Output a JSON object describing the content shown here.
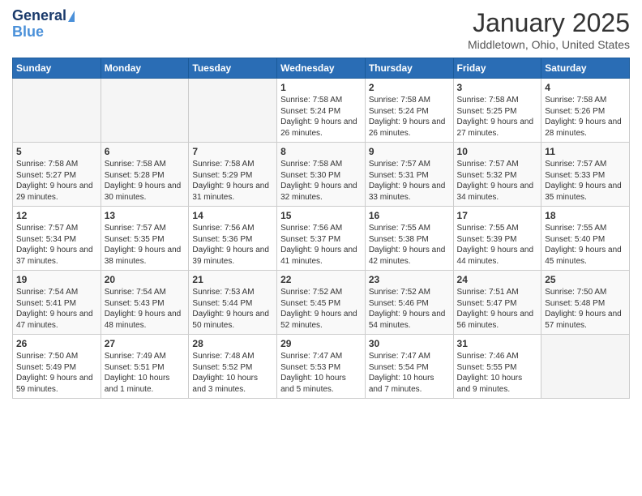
{
  "logo": {
    "line1": "General",
    "line2": "Blue"
  },
  "header": {
    "month": "January 2025",
    "location": "Middletown, Ohio, United States"
  },
  "weekdays": [
    "Sunday",
    "Monday",
    "Tuesday",
    "Wednesday",
    "Thursday",
    "Friday",
    "Saturday"
  ],
  "weeks": [
    [
      {
        "day": "",
        "sunrise": "",
        "sunset": "",
        "daylight": ""
      },
      {
        "day": "",
        "sunrise": "",
        "sunset": "",
        "daylight": ""
      },
      {
        "day": "",
        "sunrise": "",
        "sunset": "",
        "daylight": ""
      },
      {
        "day": "1",
        "sunrise": "Sunrise: 7:58 AM",
        "sunset": "Sunset: 5:24 PM",
        "daylight": "Daylight: 9 hours and 26 minutes."
      },
      {
        "day": "2",
        "sunrise": "Sunrise: 7:58 AM",
        "sunset": "Sunset: 5:24 PM",
        "daylight": "Daylight: 9 hours and 26 minutes."
      },
      {
        "day": "3",
        "sunrise": "Sunrise: 7:58 AM",
        "sunset": "Sunset: 5:25 PM",
        "daylight": "Daylight: 9 hours and 27 minutes."
      },
      {
        "day": "4",
        "sunrise": "Sunrise: 7:58 AM",
        "sunset": "Sunset: 5:26 PM",
        "daylight": "Daylight: 9 hours and 28 minutes."
      }
    ],
    [
      {
        "day": "5",
        "sunrise": "Sunrise: 7:58 AM",
        "sunset": "Sunset: 5:27 PM",
        "daylight": "Daylight: 9 hours and 29 minutes."
      },
      {
        "day": "6",
        "sunrise": "Sunrise: 7:58 AM",
        "sunset": "Sunset: 5:28 PM",
        "daylight": "Daylight: 9 hours and 30 minutes."
      },
      {
        "day": "7",
        "sunrise": "Sunrise: 7:58 AM",
        "sunset": "Sunset: 5:29 PM",
        "daylight": "Daylight: 9 hours and 31 minutes."
      },
      {
        "day": "8",
        "sunrise": "Sunrise: 7:58 AM",
        "sunset": "Sunset: 5:30 PM",
        "daylight": "Daylight: 9 hours and 32 minutes."
      },
      {
        "day": "9",
        "sunrise": "Sunrise: 7:57 AM",
        "sunset": "Sunset: 5:31 PM",
        "daylight": "Daylight: 9 hours and 33 minutes."
      },
      {
        "day": "10",
        "sunrise": "Sunrise: 7:57 AM",
        "sunset": "Sunset: 5:32 PM",
        "daylight": "Daylight: 9 hours and 34 minutes."
      },
      {
        "day": "11",
        "sunrise": "Sunrise: 7:57 AM",
        "sunset": "Sunset: 5:33 PM",
        "daylight": "Daylight: 9 hours and 35 minutes."
      }
    ],
    [
      {
        "day": "12",
        "sunrise": "Sunrise: 7:57 AM",
        "sunset": "Sunset: 5:34 PM",
        "daylight": "Daylight: 9 hours and 37 minutes."
      },
      {
        "day": "13",
        "sunrise": "Sunrise: 7:57 AM",
        "sunset": "Sunset: 5:35 PM",
        "daylight": "Daylight: 9 hours and 38 minutes."
      },
      {
        "day": "14",
        "sunrise": "Sunrise: 7:56 AM",
        "sunset": "Sunset: 5:36 PM",
        "daylight": "Daylight: 9 hours and 39 minutes."
      },
      {
        "day": "15",
        "sunrise": "Sunrise: 7:56 AM",
        "sunset": "Sunset: 5:37 PM",
        "daylight": "Daylight: 9 hours and 41 minutes."
      },
      {
        "day": "16",
        "sunrise": "Sunrise: 7:55 AM",
        "sunset": "Sunset: 5:38 PM",
        "daylight": "Daylight: 9 hours and 42 minutes."
      },
      {
        "day": "17",
        "sunrise": "Sunrise: 7:55 AM",
        "sunset": "Sunset: 5:39 PM",
        "daylight": "Daylight: 9 hours and 44 minutes."
      },
      {
        "day": "18",
        "sunrise": "Sunrise: 7:55 AM",
        "sunset": "Sunset: 5:40 PM",
        "daylight": "Daylight: 9 hours and 45 minutes."
      }
    ],
    [
      {
        "day": "19",
        "sunrise": "Sunrise: 7:54 AM",
        "sunset": "Sunset: 5:41 PM",
        "daylight": "Daylight: 9 hours and 47 minutes."
      },
      {
        "day": "20",
        "sunrise": "Sunrise: 7:54 AM",
        "sunset": "Sunset: 5:43 PM",
        "daylight": "Daylight: 9 hours and 48 minutes."
      },
      {
        "day": "21",
        "sunrise": "Sunrise: 7:53 AM",
        "sunset": "Sunset: 5:44 PM",
        "daylight": "Daylight: 9 hours and 50 minutes."
      },
      {
        "day": "22",
        "sunrise": "Sunrise: 7:52 AM",
        "sunset": "Sunset: 5:45 PM",
        "daylight": "Daylight: 9 hours and 52 minutes."
      },
      {
        "day": "23",
        "sunrise": "Sunrise: 7:52 AM",
        "sunset": "Sunset: 5:46 PM",
        "daylight": "Daylight: 9 hours and 54 minutes."
      },
      {
        "day": "24",
        "sunrise": "Sunrise: 7:51 AM",
        "sunset": "Sunset: 5:47 PM",
        "daylight": "Daylight: 9 hours and 56 minutes."
      },
      {
        "day": "25",
        "sunrise": "Sunrise: 7:50 AM",
        "sunset": "Sunset: 5:48 PM",
        "daylight": "Daylight: 9 hours and 57 minutes."
      }
    ],
    [
      {
        "day": "26",
        "sunrise": "Sunrise: 7:50 AM",
        "sunset": "Sunset: 5:49 PM",
        "daylight": "Daylight: 9 hours and 59 minutes."
      },
      {
        "day": "27",
        "sunrise": "Sunrise: 7:49 AM",
        "sunset": "Sunset: 5:51 PM",
        "daylight": "Daylight: 10 hours and 1 minute."
      },
      {
        "day": "28",
        "sunrise": "Sunrise: 7:48 AM",
        "sunset": "Sunset: 5:52 PM",
        "daylight": "Daylight: 10 hours and 3 minutes."
      },
      {
        "day": "29",
        "sunrise": "Sunrise: 7:47 AM",
        "sunset": "Sunset: 5:53 PM",
        "daylight": "Daylight: 10 hours and 5 minutes."
      },
      {
        "day": "30",
        "sunrise": "Sunrise: 7:47 AM",
        "sunset": "Sunset: 5:54 PM",
        "daylight": "Daylight: 10 hours and 7 minutes."
      },
      {
        "day": "31",
        "sunrise": "Sunrise: 7:46 AM",
        "sunset": "Sunset: 5:55 PM",
        "daylight": "Daylight: 10 hours and 9 minutes."
      },
      {
        "day": "",
        "sunrise": "",
        "sunset": "",
        "daylight": ""
      }
    ]
  ]
}
